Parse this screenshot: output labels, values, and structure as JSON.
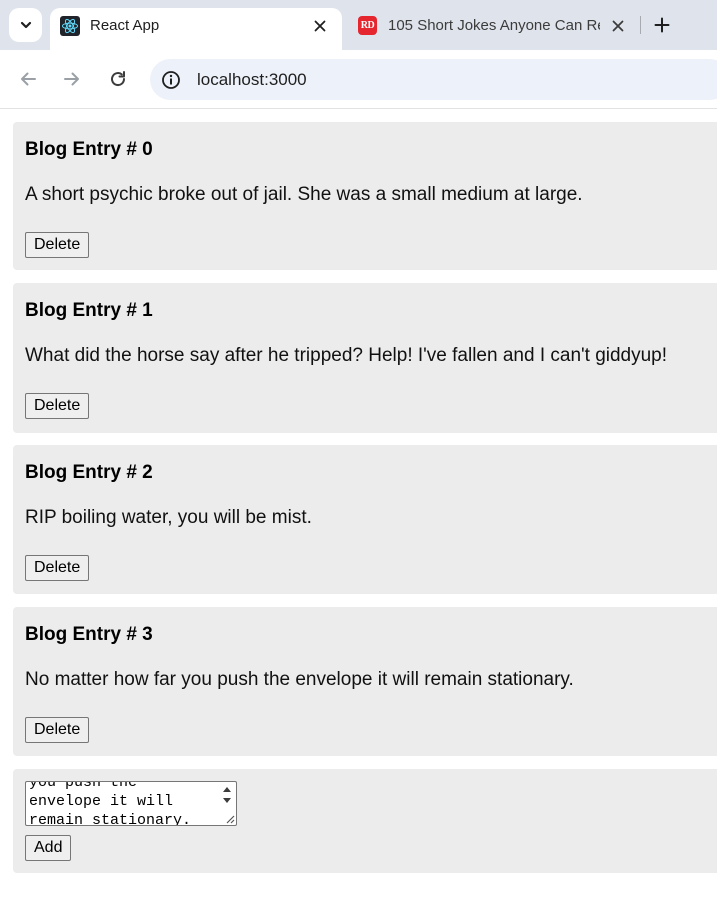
{
  "browser": {
    "tabs": [
      {
        "title": "React App",
        "favicon": "react-logo-icon",
        "active": true
      },
      {
        "title": "105 Short Jokes Anyone Can Re",
        "favicon": "rd-icon",
        "favicon_text": "RD",
        "active": false
      }
    ],
    "url": "localhost:3000"
  },
  "entries": [
    {
      "title": "Blog Entry # 0",
      "body": "A short psychic broke out of jail. She was a small medium at large.",
      "delete_label": "Delete"
    },
    {
      "title": "Blog Entry # 1",
      "body": "What did the horse say after he tripped? Help! I've fallen and I can't giddyup!",
      "delete_label": "Delete"
    },
    {
      "title": "Blog Entry # 2",
      "body": "RIP boiling water, you will be mist.",
      "delete_label": "Delete"
    },
    {
      "title": "Blog Entry # 3",
      "body": "No matter how far you push the envelope it will remain stationary.",
      "delete_label": "Delete"
    }
  ],
  "composer": {
    "textarea_value": "you push the\nenvelope it will\nremain stationary.",
    "add_label": "Add"
  },
  "colors": {
    "card_bg": "#ececec",
    "tabstrip_bg": "#dfe3eb",
    "omnibox_bg": "#edf1f9",
    "rd_red": "#e5262f"
  }
}
